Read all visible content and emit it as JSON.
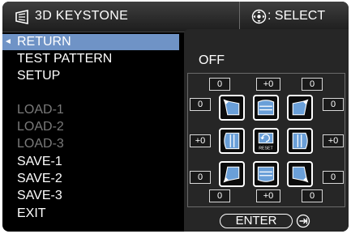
{
  "header": {
    "title": "3D KEYSTONE",
    "select_label": ": SELECT"
  },
  "menu": {
    "items": [
      {
        "label": "RETURN",
        "state": "selected"
      },
      {
        "label": "TEST PATTERN",
        "state": "normal"
      },
      {
        "label": "SETUP",
        "state": "normal"
      },
      {
        "label": "LOAD-1",
        "state": "disabled"
      },
      {
        "label": "LOAD-2",
        "state": "disabled"
      },
      {
        "label": "LOAD-3",
        "state": "disabled"
      },
      {
        "label": "SAVE-1",
        "state": "normal"
      },
      {
        "label": "SAVE-2",
        "state": "normal"
      },
      {
        "label": "SAVE-3",
        "state": "normal"
      },
      {
        "label": "EXIT",
        "state": "normal"
      }
    ]
  },
  "panel": {
    "value": "OFF",
    "numbers": {
      "top_left": "0",
      "top_center": "+0",
      "top_right": "0",
      "upper_left": "0",
      "upper_right": "0",
      "mid_left": "+0",
      "mid_right": "+0",
      "lower_left": "0",
      "lower_right": "0",
      "bottom_left": "0",
      "bottom_center": "+0",
      "bottom_right": "0"
    },
    "reset_label": "RESET",
    "enter_label": "ENTER"
  },
  "colors": {
    "selected_bg": "#6f93c6",
    "disabled_text": "#7a7a7a",
    "panel_bg": "#262626"
  }
}
